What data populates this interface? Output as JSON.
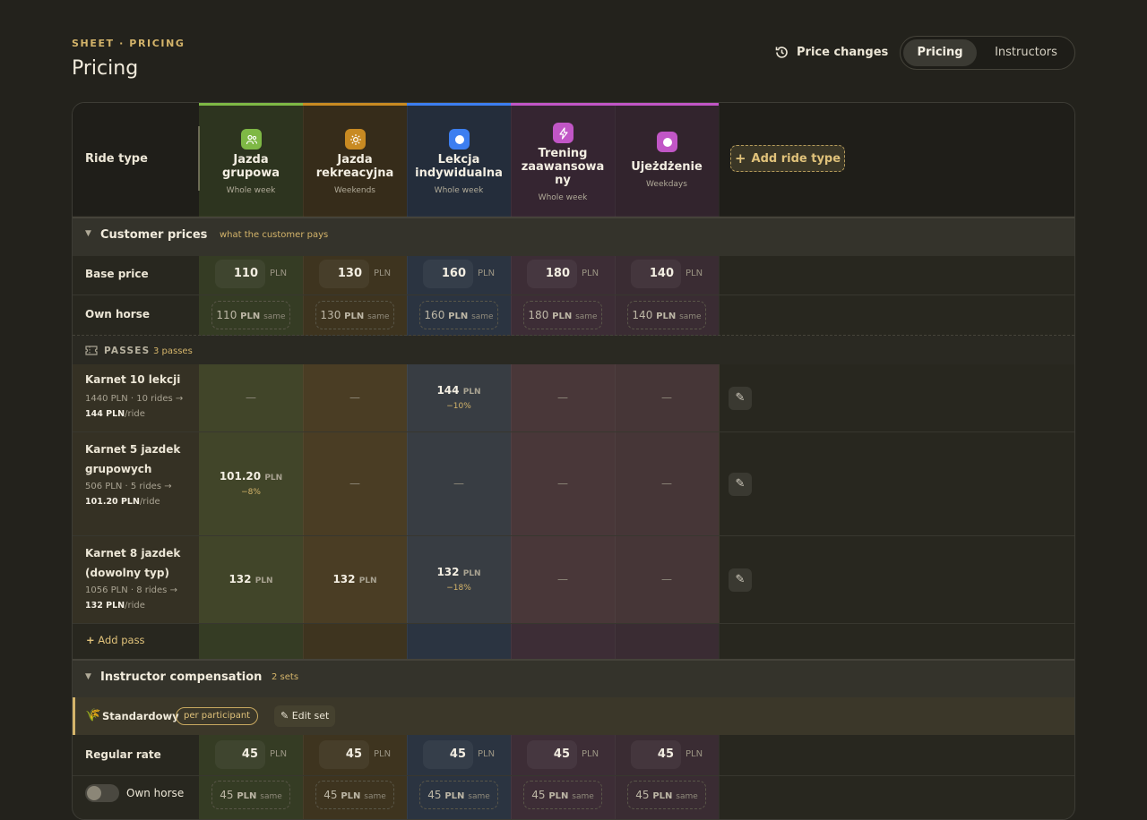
{
  "header": {
    "eyebrow": "SHEET · PRICING",
    "title": "Pricing",
    "history_label": "Price changes",
    "tabs": [
      {
        "label": "Pricing",
        "active": true
      },
      {
        "label": "Instructors",
        "active": false
      }
    ]
  },
  "table": {
    "ride_type_label": "Ride type",
    "add_ride_type_label": "Add ride type",
    "columns": [
      {
        "name": "Jazda\ngrupowa",
        "sub": "Whole week",
        "color": "#7eb845",
        "icon": "users-icon"
      },
      {
        "name": "Jazda\nrekreacyjna",
        "sub": "Weekends",
        "color": "#c88a22",
        "icon": "sun-icon"
      },
      {
        "name": "Lekcja\nindywidualna",
        "sub": "Whole week",
        "color": "#3c7ef0",
        "icon": "circle-icon"
      },
      {
        "name": "Trening\nzaawansowa\nny",
        "sub": "Whole week",
        "color": "#c156c6",
        "icon": "bolt-icon"
      },
      {
        "name": "Ujeżdżenie",
        "sub": "Weekdays",
        "color": "#c156c6",
        "icon": "circle-icon"
      }
    ]
  },
  "customer": {
    "title": "Customer prices",
    "hint": "what the customer pays",
    "base_label": "Base price",
    "own_label": "Own horse",
    "unit": "PLN",
    "same": "same",
    "base": [
      "110",
      "130",
      "160",
      "180",
      "140"
    ],
    "own": [
      "110",
      "130",
      "160",
      "180",
      "140"
    ]
  },
  "passes": {
    "title": "PASSES",
    "count": "3 passes",
    "add_label": "Add pass",
    "items": [
      {
        "name": "Karnet 10 lekcji",
        "sub_a": "1440 PLN · 10 rides →",
        "sub_b": "144 PLN",
        "sub_c": "/ride",
        "cells": [
          null,
          null,
          {
            "v": "144",
            "d": "−10%"
          },
          null,
          null
        ]
      },
      {
        "name": "Karnet 5 jazdek grupowych",
        "sub_a": "506 PLN · 5 rides →",
        "sub_b": "101.20 PLN",
        "sub_c": "/ride",
        "cells": [
          {
            "v": "101.20",
            "d": "−8%"
          },
          null,
          null,
          null,
          null
        ]
      },
      {
        "name": "Karnet 8 jazdek (dowolny typ)",
        "sub_a": "1056 PLN · 8 rides →",
        "sub_b": "132 PLN",
        "sub_c": "/ride",
        "cells": [
          {
            "v": "132",
            "d": ""
          },
          {
            "v": "132",
            "d": ""
          },
          {
            "v": "132",
            "d": "−18%"
          },
          null,
          null
        ]
      }
    ]
  },
  "instructor": {
    "title": "Instructor compensation",
    "count": "2 sets",
    "set_name": "Standardowy",
    "set_badge": "per participant",
    "edit_label": "✎ Edit set",
    "regular_label": "Regular rate",
    "own_label": "Own horse",
    "regular": [
      "45",
      "45",
      "45",
      "45",
      "45"
    ],
    "own": [
      "45",
      "45",
      "45",
      "45",
      "45"
    ]
  },
  "colors": {
    "accent": "#d4b46a"
  },
  "empty": "—"
}
